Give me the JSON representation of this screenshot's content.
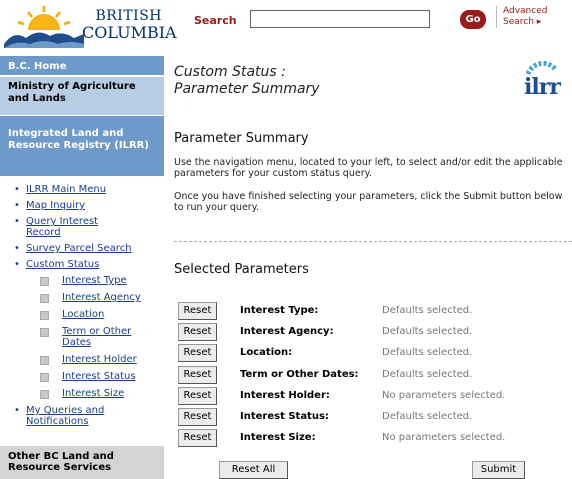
{
  "header": {
    "logo_line1": "BRITISH",
    "logo_line2": "COLUMBIA",
    "search_label": "Search",
    "search_value": "",
    "go_label": "Go",
    "advanced_line1": "Advanced",
    "advanced_line2": "Search ▸"
  },
  "leftnav": {
    "home": "B.C. Home",
    "ministry": "Ministry of Agriculture and Lands",
    "ilrr": "Integrated Land and Resource Registry (ILRR)",
    "items": [
      {
        "label": "ILRR Main Menu"
      },
      {
        "label": "Map Inquiry"
      },
      {
        "label": "Query Interest Record"
      },
      {
        "label": "Survey Parcel Search"
      },
      {
        "label": "Custom Status"
      }
    ],
    "sub_items": [
      {
        "label": "Interest Type"
      },
      {
        "label": "Interest Agency"
      },
      {
        "label": "Location"
      },
      {
        "label": "Term or Other Dates"
      },
      {
        "label": "Interest Holder"
      },
      {
        "label": "Interest Status"
      },
      {
        "label": "Interest Size"
      }
    ],
    "queries": "My Queries and Notifications",
    "other": "Other BC Land and Resource Services"
  },
  "main": {
    "title_line1": "Custom Status :",
    "title_line2": "Parameter Summary",
    "logo_text": "ilrr",
    "summary_heading": "Parameter Summary",
    "para1": "Use the navigation menu, located to your left, to select and/or edit the applicable parameters for your custom status query.",
    "para2": "Once you have finished selecting your parameters, click the Submit button below to run your query.",
    "selected_heading": "Selected Parameters",
    "reset_label": "Reset",
    "params": [
      {
        "label": "Interest Type:",
        "value": "Defaults selected."
      },
      {
        "label": "Interest Agency:",
        "value": "Defaults selected."
      },
      {
        "label": "Location:",
        "value": "Defaults selected."
      },
      {
        "label": "Term or Other Dates:",
        "value": "Defaults selected."
      },
      {
        "label": "Interest Holder:",
        "value": "No parameters selected."
      },
      {
        "label": "Interest Status:",
        "value": "Defaults selected."
      },
      {
        "label": "Interest Size:",
        "value": "No parameters selected."
      }
    ],
    "reset_all_label": "Reset All",
    "submit_label": "Submit"
  },
  "colors": {
    "nav_blue": "#6d9ac8",
    "nav_light": "#b6cde3",
    "brand_red": "#9b1b1b",
    "link": "#1a3f8f"
  }
}
